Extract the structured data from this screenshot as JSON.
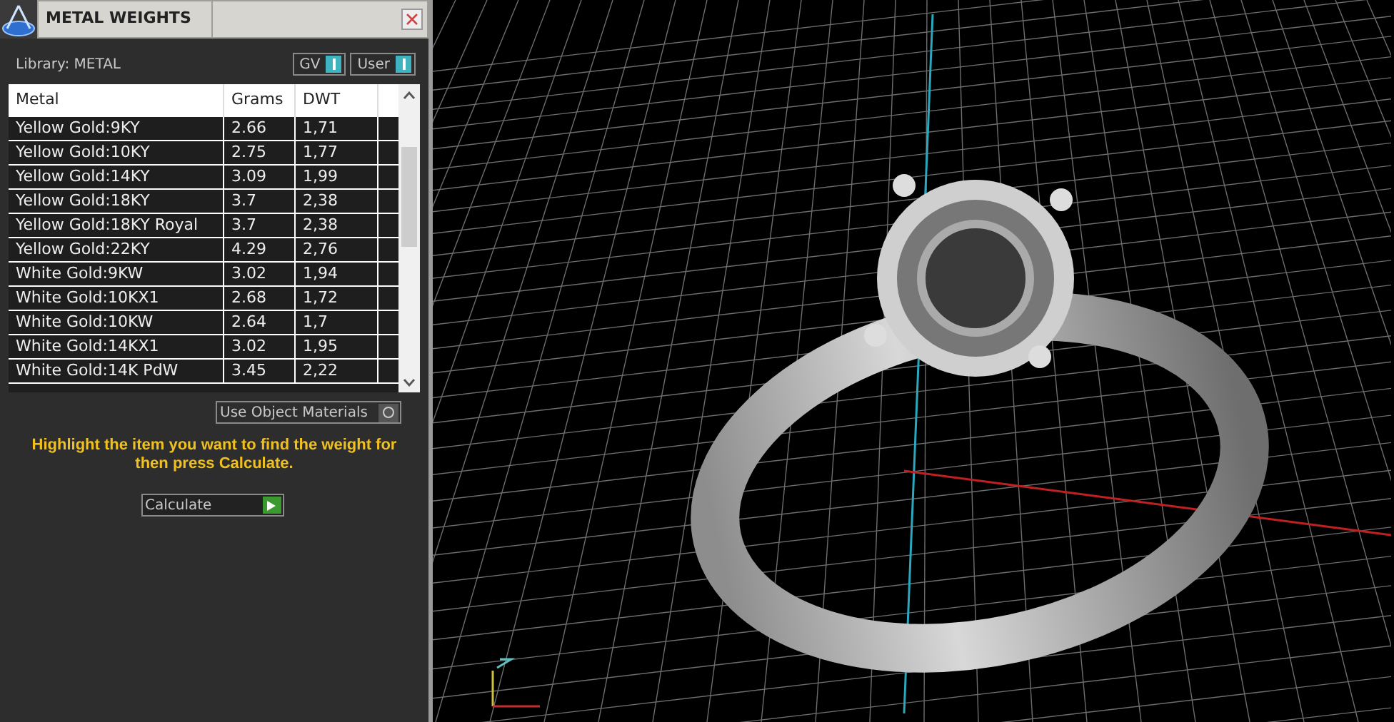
{
  "panel": {
    "title": "METAL WEIGHTS",
    "library": "Library: METAL",
    "toggles": [
      {
        "label": "GV",
        "on": true
      },
      {
        "label": "User",
        "on": true
      }
    ],
    "table": {
      "columns": [
        "Metal",
        "Grams",
        "DWT"
      ],
      "rows": [
        [
          "Yellow Gold:9KY",
          "2.66",
          "1,71"
        ],
        [
          "Yellow Gold:10KY",
          "2.75",
          "1,77"
        ],
        [
          "Yellow Gold:14KY",
          "3.09",
          "1,99"
        ],
        [
          "Yellow Gold:18KY",
          "3.7",
          "2,38"
        ],
        [
          "Yellow Gold:18KY Royal",
          "3.7",
          "2,38"
        ],
        [
          "Yellow Gold:22KY",
          "4.29",
          "2,76"
        ],
        [
          "White Gold:9KW",
          "3.02",
          "1,94"
        ],
        [
          "White Gold:10KX1",
          "2.68",
          "1,72"
        ],
        [
          "White Gold:10KW",
          "2.64",
          "1,7"
        ],
        [
          "White Gold:14KX1",
          "3.02",
          "1,95"
        ],
        [
          "White Gold:14K PdW",
          "3.45",
          "2,22"
        ]
      ]
    },
    "use_object_materials": {
      "label": "Use Object Materials",
      "on": false
    },
    "hint": "Highlight the item you want to find the weight for then press Calculate.",
    "calculate": "Calculate"
  }
}
